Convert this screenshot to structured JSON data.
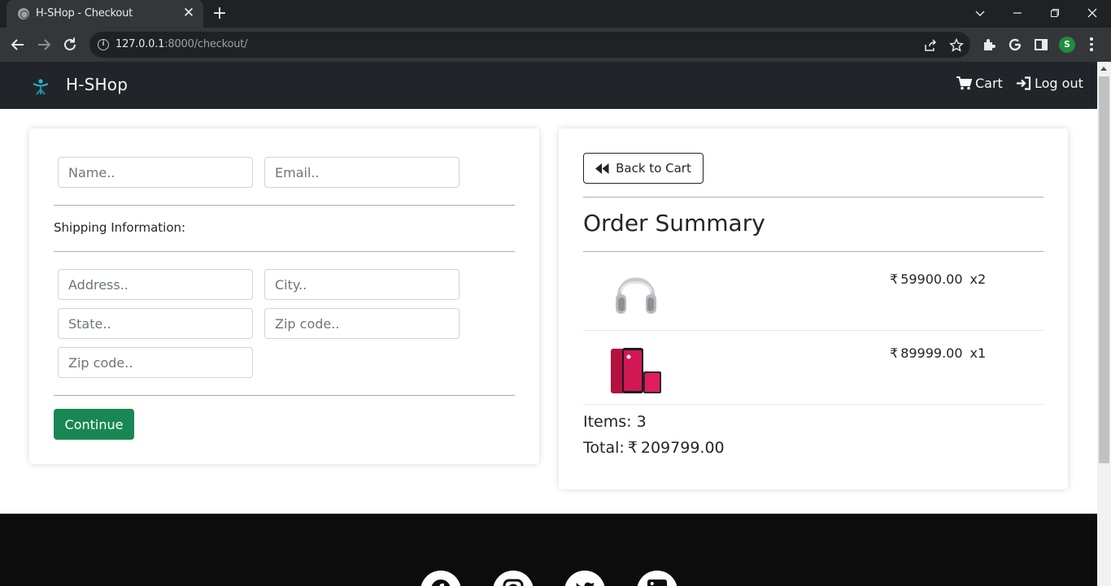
{
  "browser": {
    "tab_title": "H-SHop - Checkout",
    "url_host": "127.0.0.1",
    "url_path": ":8000/checkout/",
    "profile_initial": "S"
  },
  "navbar": {
    "brand": "H-SHop",
    "cart_label": "Cart",
    "logout_label": "Log out"
  },
  "form": {
    "name_placeholder": "Name..",
    "email_placeholder": "Email..",
    "shipping_heading": "Shipping Information:",
    "address_placeholder": "Address..",
    "city_placeholder": "City..",
    "state_placeholder": "State..",
    "zip_placeholder": "Zip code..",
    "zip2_placeholder": "Zip code..",
    "continue_label": "Continue"
  },
  "summary": {
    "back_label": "Back to Cart",
    "title": "Order Summary",
    "currency_symbol": "₹",
    "items": [
      {
        "image": "headphones-image",
        "price": "59900.00",
        "qty": "x2"
      },
      {
        "image": "phone-image",
        "price": "89999.00",
        "qty": "x1"
      }
    ],
    "items_count": "Items: 3",
    "total_label": "Total:",
    "total_value": "209799.00"
  },
  "colors": {
    "navbar_bg": "#212529",
    "button_success": "#198754",
    "footer_bg": "#0c0c0c"
  }
}
